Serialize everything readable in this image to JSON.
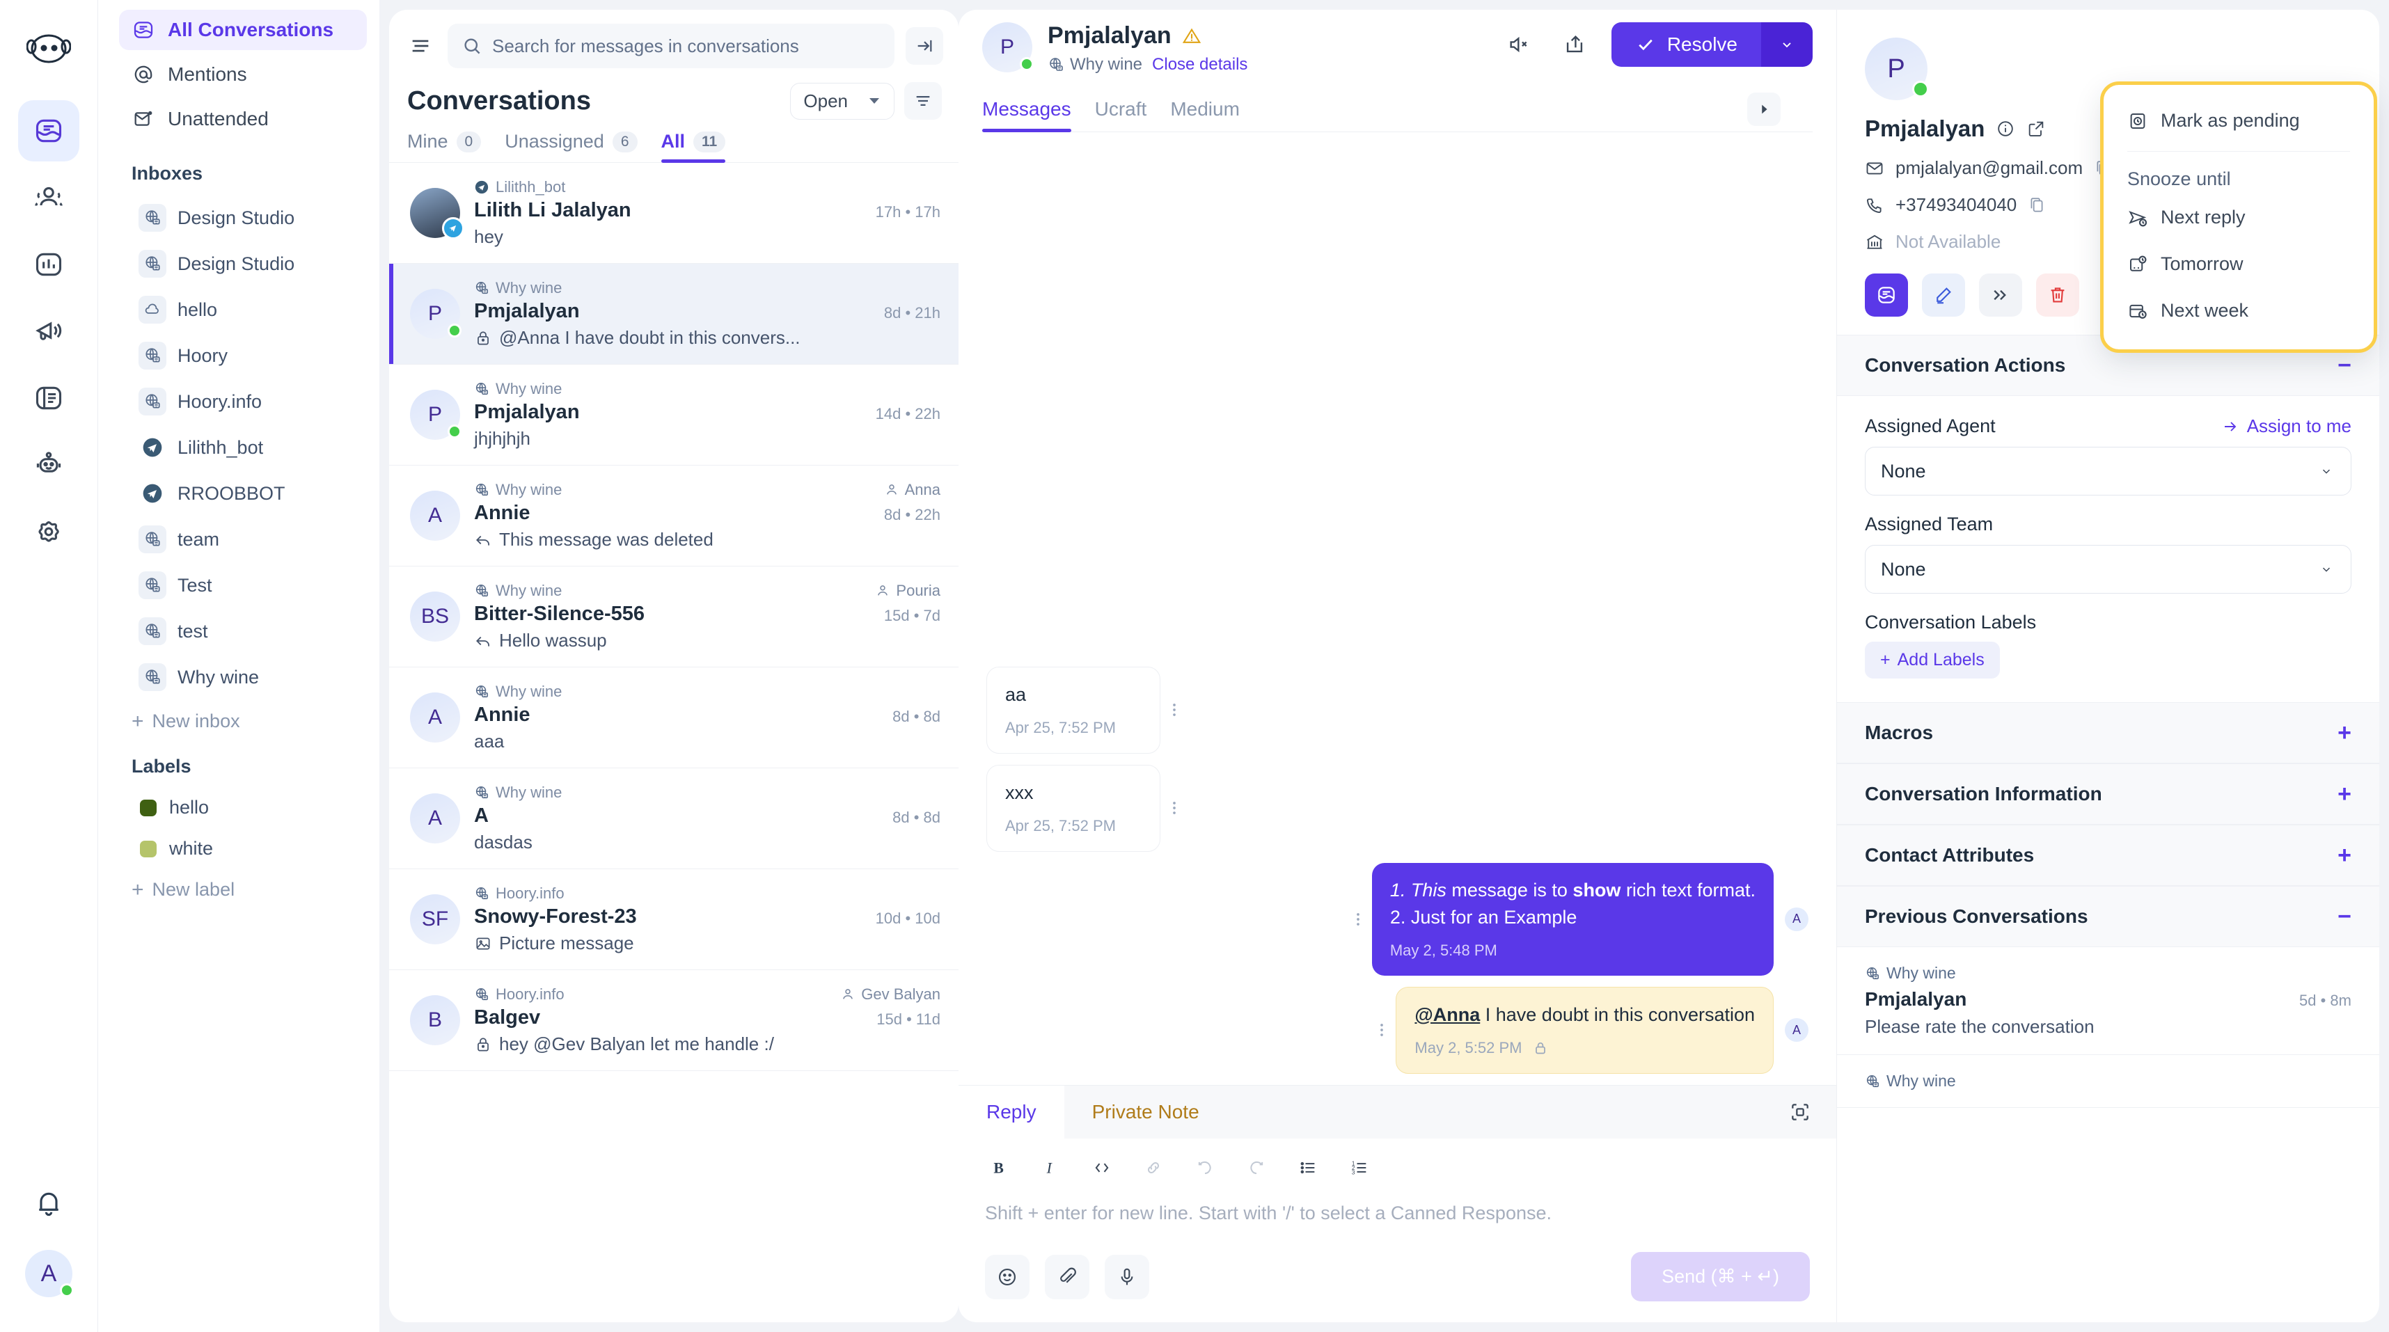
{
  "rail": {
    "logo_icon": "hoory-logo",
    "items": [
      {
        "name": "conversations",
        "icon": "inbox-icon",
        "active": true
      },
      {
        "name": "contacts",
        "icon": "contacts-icon",
        "active": false
      },
      {
        "name": "reports",
        "icon": "bar-chart-icon",
        "active": false
      },
      {
        "name": "campaigns",
        "icon": "megaphone-icon",
        "active": false
      },
      {
        "name": "help-center",
        "icon": "book-icon",
        "active": false
      },
      {
        "name": "bots",
        "icon": "robot-icon",
        "active": false
      },
      {
        "name": "settings",
        "icon": "gear-icon",
        "active": false
      }
    ],
    "notifications_icon": "bell-icon",
    "avatar_initial": "A"
  },
  "sidebar": {
    "primary": [
      {
        "label": "All Conversations",
        "icon": "inbox-icon",
        "active": true
      },
      {
        "label": "Mentions",
        "icon": "at-icon",
        "active": false
      },
      {
        "label": "Unattended",
        "icon": "mail-dot-icon",
        "active": false
      }
    ],
    "inboxes_heading": "Inboxes",
    "inboxes": [
      {
        "label": "Design Studio",
        "icon": "website-icon"
      },
      {
        "label": "Design Studio",
        "icon": "website-icon"
      },
      {
        "label": "hello",
        "icon": "cloud-icon"
      },
      {
        "label": "Hoory",
        "icon": "website-icon"
      },
      {
        "label": "Hoory.info",
        "icon": "website-icon"
      },
      {
        "label": "Lilithh_bot",
        "icon": "telegram-icon"
      },
      {
        "label": "RROOBBOT",
        "icon": "telegram-icon"
      },
      {
        "label": "team",
        "icon": "website-icon"
      },
      {
        "label": "Test",
        "icon": "website-icon"
      },
      {
        "label": "test",
        "icon": "website-icon"
      },
      {
        "label": "Why wine",
        "icon": "website-icon"
      }
    ],
    "new_inbox_label": "New inbox",
    "labels_heading": "Labels",
    "labels": [
      {
        "label": "hello",
        "color": "#3f6012"
      },
      {
        "label": "white",
        "color": "#b5c46a"
      }
    ],
    "new_label_label": "New label"
  },
  "conversation_list": {
    "search_placeholder": "Search for messages in conversations",
    "search_icon": "search-icon",
    "menu_icon": "hamburger-icon",
    "collapse_icon": "collapse-panel-icon",
    "title": "Conversations",
    "status_filter": "Open",
    "filter_icon": "filter-icon",
    "tabs": [
      {
        "label": "Mine",
        "count": "0",
        "active": false
      },
      {
        "label": "Unassigned",
        "count": "6",
        "active": false
      },
      {
        "label": "All",
        "count": "11",
        "active": true
      }
    ],
    "rows": [
      {
        "inbox": "Lilithh_bot",
        "inbox_icon": "telegram-icon",
        "name": "Lilith Li Jalalyan",
        "time": "17h • 17h",
        "preview": "hey",
        "preview_icon": "",
        "avatar": "",
        "avatar_kind": "photo",
        "online": false,
        "channel_badge": "telegram",
        "assignee": "",
        "selected": false
      },
      {
        "inbox": "Why wine",
        "inbox_icon": "website-icon",
        "name": "Pmjalalyan",
        "time": "8d • 21h",
        "preview": "@Anna I have doubt in this convers...",
        "preview_icon": "lock-icon",
        "avatar": "P",
        "avatar_kind": "initial",
        "online": true,
        "channel_badge": "",
        "assignee": "",
        "selected": true
      },
      {
        "inbox": "Why wine",
        "inbox_icon": "website-icon",
        "name": "Pmjalalyan",
        "time": "14d • 22h",
        "preview": "jhjhjhjh",
        "preview_icon": "",
        "avatar": "P",
        "avatar_kind": "initial",
        "online": true,
        "channel_badge": "",
        "assignee": "",
        "selected": false
      },
      {
        "inbox": "Why wine",
        "inbox_icon": "website-icon",
        "name": "Annie",
        "time": "8d • 22h",
        "preview": "This message was deleted",
        "preview_icon": "reply-icon",
        "avatar": "A",
        "avatar_kind": "initial",
        "online": false,
        "channel_badge": "",
        "assignee": "Anna",
        "selected": false
      },
      {
        "inbox": "Why wine",
        "inbox_icon": "website-icon",
        "name": "Bitter-Silence-556",
        "time": "15d • 7d",
        "preview": "Hello wassup",
        "preview_icon": "reply-icon",
        "avatar": "BS",
        "avatar_kind": "initial",
        "online": false,
        "channel_badge": "",
        "assignee": "Pouria",
        "selected": false
      },
      {
        "inbox": "Why wine",
        "inbox_icon": "website-icon",
        "name": "Annie",
        "time": "8d • 8d",
        "preview": "aaa",
        "preview_icon": "",
        "avatar": "A",
        "avatar_kind": "initial",
        "online": false,
        "channel_badge": "",
        "assignee": "",
        "selected": false
      },
      {
        "inbox": "Why wine",
        "inbox_icon": "website-icon",
        "name": "A",
        "time": "8d • 8d",
        "preview": "dasdas",
        "preview_icon": "",
        "avatar": "A",
        "avatar_kind": "initial",
        "online": false,
        "channel_badge": "",
        "assignee": "",
        "selected": false
      },
      {
        "inbox": "Hoory.info",
        "inbox_icon": "website-icon",
        "name": "Snowy-Forest-23",
        "time": "10d • 10d",
        "preview": "Picture message",
        "preview_icon": "image-icon",
        "avatar": "SF",
        "avatar_kind": "initial",
        "online": false,
        "channel_badge": "",
        "assignee": "",
        "selected": false
      },
      {
        "inbox": "Hoory.info",
        "inbox_icon": "website-icon",
        "name": "Balgev",
        "time": "15d • 11d",
        "preview": "hey @Gev Balyan let me handle :/",
        "preview_icon": "lock-icon",
        "avatar": "B",
        "avatar_kind": "initial",
        "online": false,
        "channel_badge": "",
        "assignee": "Gev Balyan",
        "selected": false
      }
    ]
  },
  "chat": {
    "avatar_initial": "P",
    "name": "Pmjalalyan",
    "warning_icon": "warning-triangle-icon",
    "inbox": "Why wine",
    "inbox_icon": "website-icon",
    "close_details": "Close details",
    "mute_icon": "mute-icon",
    "share_icon": "share-icon",
    "resolve_label": "Resolve",
    "resolve_check_icon": "check-icon",
    "resolve_caret_icon": "chevron-down-icon",
    "tabs": [
      {
        "label": "Messages",
        "active": true
      },
      {
        "label": "Ucraft",
        "active": false
      },
      {
        "label": "Medium",
        "active": false
      }
    ],
    "tabs_next_icon": "caret-right-icon",
    "messages": [
      {
        "kind": "in",
        "text": "aa",
        "time": "Apr 25, 7:52 PM",
        "avatar": "",
        "lock": false
      },
      {
        "kind": "in",
        "text": "xxx",
        "time": "Apr 25, 7:52 PM",
        "avatar": "",
        "lock": false
      },
      {
        "kind": "out",
        "lines": [
          "1. This message is to show rich text format.",
          "2. Just for an Example"
        ],
        "time": "May 2, 5:48 PM",
        "avatar": "A",
        "lock": false
      },
      {
        "kind": "note",
        "mention": "@Anna",
        "text": " I have doubt in this conversation",
        "time": "May 2, 5:52 PM",
        "avatar": "A",
        "lock": true
      }
    ]
  },
  "composer": {
    "tabs": [
      {
        "label": "Reply",
        "active": true
      },
      {
        "label": "Private Note",
        "active": false
      }
    ],
    "expand_icon": "expand-icon",
    "tools": [
      "bold-icon",
      "italic-icon",
      "code-icon",
      "link-icon",
      "undo-icon",
      "redo-icon",
      "bullet-list-icon",
      "numbered-list-icon"
    ],
    "placeholder": "Shift + enter for new line. Start with '/' to select a Canned Response.",
    "bottom_icons": [
      "emoji-icon",
      "attachment-icon",
      "microphone-icon"
    ],
    "send_label": "Send (⌘ + ↵)"
  },
  "dropdown": {
    "mark_pending": {
      "label": "Mark as pending",
      "icon": "pending-clock-icon"
    },
    "snooze_heading": "Snooze until",
    "items": [
      {
        "label": "Next reply",
        "icon": "next-reply-icon"
      },
      {
        "label": "Tomorrow",
        "icon": "tomorrow-icon"
      },
      {
        "label": "Next week",
        "icon": "next-week-icon"
      }
    ],
    "highlight_color": "#fbcf4a"
  },
  "contact_panel": {
    "avatar_initial": "P",
    "name": "Pmjalalyan",
    "info_icon": "info-icon",
    "external_icon": "external-link-icon",
    "email": "pmjalalyan@gmail.com",
    "email_icon": "mail-icon",
    "copy_icon": "copy-icon",
    "phone": "+37493404040",
    "phone_icon": "phone-icon",
    "company": "Not Available",
    "company_icon": "company-icon",
    "actions": [
      {
        "name": "conversation-icon"
      },
      {
        "name": "edit-icon"
      },
      {
        "name": "merge-icon"
      },
      {
        "name": "delete-icon"
      }
    ],
    "sections": [
      {
        "title": "Conversation Actions",
        "sign": "−",
        "expanded": true
      },
      {
        "title": "Macros",
        "sign": "+",
        "expanded": false
      },
      {
        "title": "Conversation Information",
        "sign": "+",
        "expanded": false
      },
      {
        "title": "Contact Attributes",
        "sign": "+",
        "expanded": false
      },
      {
        "title": "Previous Conversations",
        "sign": "−",
        "expanded": true
      }
    ],
    "assigned_agent_label": "Assigned Agent",
    "assign_to_me": "Assign to me",
    "assign_to_me_icon": "arrow-right-icon",
    "assigned_agent_value": "None",
    "assigned_team_label": "Assigned Team",
    "assigned_team_value": "None",
    "conversation_labels_label": "Conversation Labels",
    "add_labels_label": "Add Labels",
    "previous_conversations": [
      {
        "inbox": "Why wine",
        "name": "Pmjalalyan",
        "time": "5d • 8m",
        "message": "Please rate the conversation"
      },
      {
        "inbox": "Why wine",
        "name": "",
        "time": "",
        "message": ""
      }
    ]
  }
}
